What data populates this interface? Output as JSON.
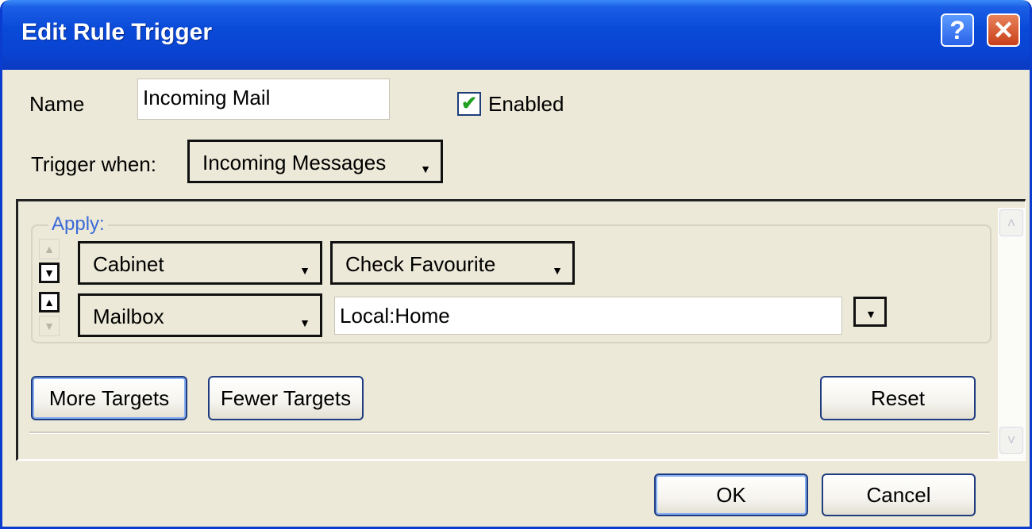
{
  "window": {
    "title": "Edit Rule Trigger",
    "help_glyph": "?",
    "close_glyph": "✕"
  },
  "form": {
    "name_label": "Name",
    "name_value": "Incoming Mail",
    "enabled_label": "Enabled",
    "enabled_checked": true,
    "trigger_label": "Trigger when:",
    "trigger_value": "Incoming Messages"
  },
  "apply": {
    "legend": "Apply:",
    "rows": [
      {
        "type": "Cabinet",
        "action": "Check Favourite"
      },
      {
        "type": "Mailbox",
        "target": "Local:Home"
      }
    ]
  },
  "buttons": {
    "more_targets": "More Targets",
    "fewer_targets": "Fewer Targets",
    "reset": "Reset",
    "ok": "OK",
    "cancel": "Cancel"
  },
  "icons": {
    "arrow_up": "▲",
    "arrow_down": "▼",
    "dropdown": "▼",
    "scroll_up": "˄",
    "scroll_down": "˅",
    "check": "✔"
  }
}
